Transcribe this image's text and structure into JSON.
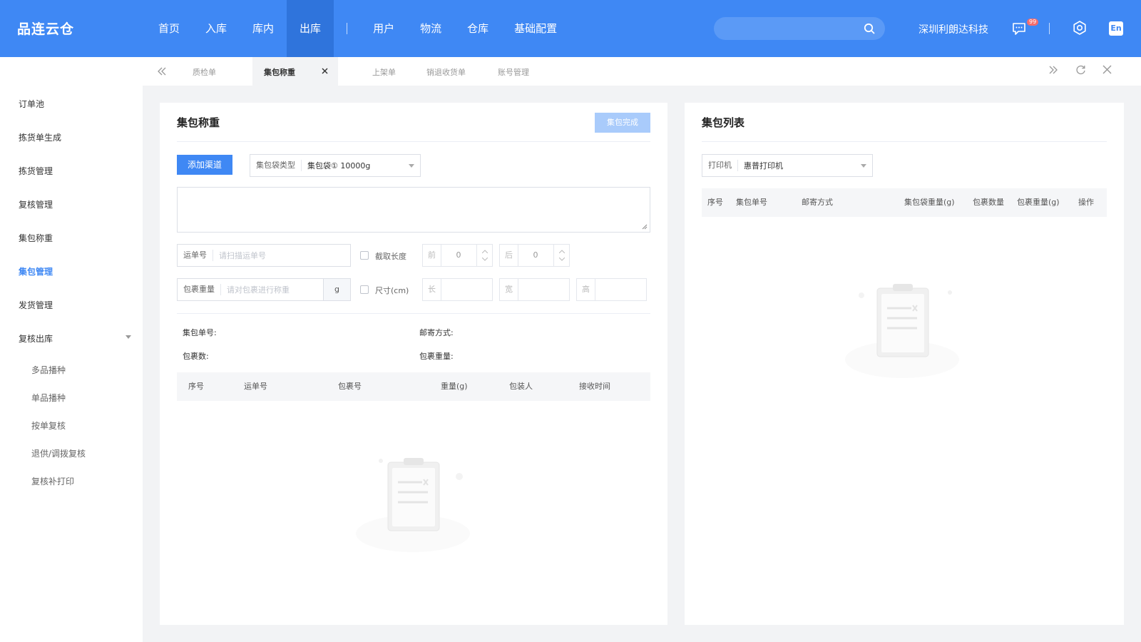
{
  "header": {
    "brand": "品连云仓",
    "nav": [
      {
        "label": "首页",
        "active": false
      },
      {
        "label": "入库",
        "active": false
      },
      {
        "label": "库内",
        "active": false
      },
      {
        "label": "出库",
        "active": true
      },
      {
        "label": "用户",
        "active": false
      },
      {
        "label": "物流",
        "active": false
      },
      {
        "label": "仓库",
        "active": false
      },
      {
        "label": "基础配置",
        "active": false
      }
    ],
    "search_placeholder": "",
    "company": "深圳利朗达科技",
    "message_badge": "99",
    "lang": "En",
    "accent": "#3f88f4"
  },
  "sidebar": {
    "items": [
      "订单池",
      "拣货单生成",
      "拣货管理",
      "复核管理",
      "集包称重",
      "集包管理",
      "发货管理",
      "复核出库"
    ],
    "active": "集包管理",
    "subitems": [
      "多品播种",
      "单品播种",
      "按单复核",
      "退供/调拨复核",
      "复核补打印"
    ]
  },
  "tabs": {
    "items": [
      "质检单",
      "集包称重",
      "上架单",
      "销退收货单",
      "账号管理"
    ],
    "active": "集包称重"
  },
  "left_panel": {
    "title": "集包称重",
    "complete_button": "集包完成",
    "add_channel_button": "添加渠道",
    "bag_type": {
      "label": "集包袋类型",
      "value": "集包袋① 10000g"
    },
    "waybill": {
      "label": "运单号",
      "placeholder": "请扫描运单号"
    },
    "cut_length": {
      "label": "截取长度",
      "front_label": "前",
      "front_value": "0",
      "back_label": "后",
      "back_value": "0"
    },
    "weight": {
      "label": "包裹重量",
      "placeholder": "请对包裹进行称重",
      "unit": "g"
    },
    "size": {
      "label": "尺寸(cm)",
      "l": "长",
      "w": "宽",
      "h": "高"
    },
    "info": {
      "bag_no": "集包单号:",
      "mail_method": "邮寄方式:",
      "count": "包裹数:",
      "total_weight": "包裹重量:"
    },
    "columns": [
      "序号",
      "运单号",
      "包裹号",
      "重量(g)",
      "包装人",
      "接收时间"
    ]
  },
  "right_panel": {
    "title": "集包列表",
    "printer": {
      "label": "打印机",
      "value": "惠普打印机"
    },
    "columns": [
      "序号",
      "集包单号",
      "邮寄方式",
      "集包袋重量(g)",
      "包裹数量",
      "包裹重量(g)",
      "操作"
    ]
  }
}
